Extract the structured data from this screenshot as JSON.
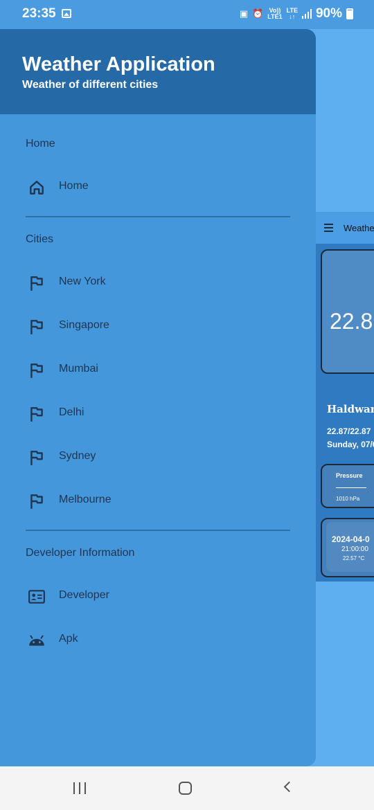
{
  "status_bar": {
    "time": "23:35",
    "volte": "Vo))",
    "lte1": "LTE1",
    "lte": "LTE",
    "arrows": "↓↑",
    "battery": "90%"
  },
  "background_app": {
    "toolbar_title": "Weathe",
    "temperature": "22.8",
    "city": "Haldwani",
    "temps_line": "22.87/22.87",
    "date_line": "Sunday, 07/0",
    "pressure_label": "Pressure",
    "pressure_value": "1010 hPa",
    "forecast_date": "2024-04-0",
    "forecast_time": "21:00:00",
    "forecast_temp": "22.57 °C"
  },
  "drawer": {
    "title": "Weather Application",
    "subtitle": "Weather of different cities",
    "sections": [
      {
        "label": "Home",
        "items": [
          {
            "label": "Home",
            "icon": "home-icon"
          }
        ]
      },
      {
        "label": "Cities",
        "items": [
          {
            "label": "New York",
            "icon": "flag-icon"
          },
          {
            "label": "Singapore",
            "icon": "flag-icon"
          },
          {
            "label": "Mumbai",
            "icon": "flag-icon"
          },
          {
            "label": "Delhi",
            "icon": "flag-icon"
          },
          {
            "label": "Sydney",
            "icon": "flag-icon"
          },
          {
            "label": "Melbourne",
            "icon": "flag-icon"
          }
        ]
      },
      {
        "label": "Developer Information",
        "items": [
          {
            "label": "Developer",
            "icon": "contact-card-icon"
          },
          {
            "label": "Apk",
            "icon": "android-icon"
          }
        ]
      }
    ]
  },
  "colors": {
    "drawer_bg": "#4597db",
    "header_bg": "#2569a6",
    "text_dark": "#1f3550",
    "screen_bg": "#5eaff0"
  }
}
